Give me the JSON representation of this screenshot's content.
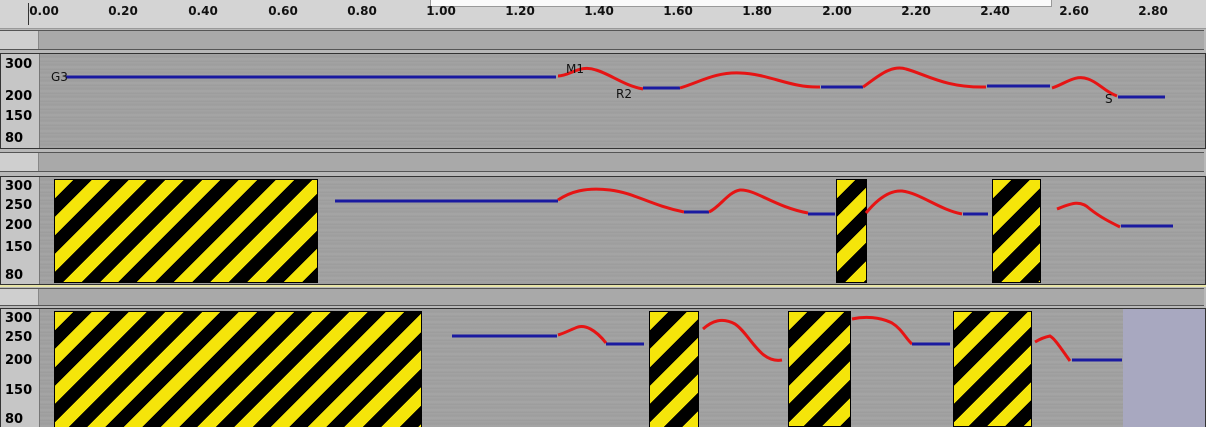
{
  "ruler": {
    "ticks": [
      "0.00",
      "0.20",
      "0.40",
      "0.60",
      "0.80",
      "1.00",
      "1.20",
      "1.40",
      "1.60",
      "1.80",
      "2.00",
      "2.20",
      "2.40",
      "2.60",
      "2.80"
    ]
  },
  "tracks": [
    {
      "axis_labels": [
        "300",
        "200",
        "150",
        "80"
      ],
      "segment_labels": {
        "g3": "G3",
        "m1": "M1",
        "r2": "R2",
        "s": "S"
      }
    },
    {
      "axis_labels": [
        "300",
        "250",
        "200",
        "150",
        "80"
      ]
    },
    {
      "axis_labels": [
        "300",
        "250",
        "200",
        "150",
        "80"
      ]
    }
  ],
  "colors": {
    "hold_line": "#1a1aa0",
    "contour_line": "#e61414",
    "hazard_yellow": "#f5e50a"
  }
}
